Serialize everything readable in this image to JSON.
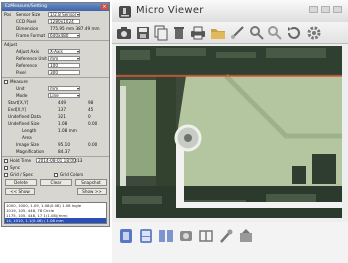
{
  "panel": {
    "title": "EzMeasure/Setting",
    "rows": [
      {
        "label": "Pos",
        "field": "Sensor Size",
        "value": "1/2.8 Sensor"
      },
      {
        "label": "",
        "field": "CCD Pixel",
        "value": "1280x1024"
      },
      {
        "label": "",
        "field": "Dimension",
        "value": "775.95 mm  387.49 mm"
      },
      {
        "label": "",
        "field": "Frame Format",
        "value": "640x480"
      }
    ],
    "adjust_label": "Adjust",
    "adjust_rows": [
      {
        "field": "Adjust Axis",
        "value": "X-Axis"
      },
      {
        "field": "Reference Unit",
        "value": "mm"
      },
      {
        "field": "Reference",
        "value": "100"
      },
      {
        "field": "Pixel",
        "value": "300"
      }
    ],
    "measure_label": "Measure",
    "measure_rows": [
      {
        "field": "Unit",
        "value": "mm"
      },
      {
        "field": "Mode",
        "value": "Line"
      }
    ],
    "result_rows": [
      {
        "field": "Start[X,Y]",
        "v1": "449",
        "v2": "98"
      },
      {
        "field": "End[X,Y]",
        "v1": "137",
        "v2": "45"
      },
      {
        "field": "Undefined Data",
        "v1": "321",
        "v2": "0"
      },
      {
        "field": "Undefined Size",
        "v1": "1.08",
        "v2": "0.00"
      },
      {
        "field": "Length",
        "v1": "1.08 mm",
        "v2": ""
      },
      {
        "field": "Area",
        "v1": "",
        "v2": ""
      }
    ],
    "image_rows": [
      {
        "field": "Image Size",
        "v1": "95.10",
        "v2": "0.00"
      },
      {
        "field": "Magnification",
        "v1": "84.37",
        "v2": ""
      }
    ],
    "time_row": {
      "field": "Hold Time",
      "value": "2014-08-01  18:00:13"
    },
    "option_rows": [
      {
        "label": "Sync"
      },
      {
        "label": "Grid / Spec",
        "extra": "Grid Colors"
      }
    ],
    "buttons": [
      "Delete",
      "Clear",
      "Snapshot"
    ],
    "nav": {
      "prev": "<< Show",
      "next": "Show >>"
    },
    "history": [
      "1000, 1000, 1.09, 1.08(0.08) 1.08 Ingle",
      "1019, 105, 448, 78 Circle",
      "1175, 105, 448, 17 1(1.08)(mm)",
      "14, 1010, 1.1(0.46) / 1.08 mm"
    ]
  },
  "viewer": {
    "title": "Micro Viewer",
    "toolbar_icons": [
      "camera-icon",
      "save-icon",
      "copy-icon",
      "trash-icon",
      "print-icon",
      "folder-icon",
      "measure-icon",
      "zoom-icon",
      "zoom-out-icon",
      "refresh-icon",
      "settings-icon"
    ],
    "bottom_icons": [
      "live-icon",
      "gallery-icon",
      "compare-icon",
      "record-icon",
      "split-icon",
      "tools-icon",
      "export-icon"
    ],
    "colors": {
      "board_green": "#b4c6a0",
      "board_dark": "#3d4a3b",
      "trace_white": "#f2f2f2",
      "measure_line": "#e2542c",
      "pad_silver": "#c8ccc4"
    }
  }
}
